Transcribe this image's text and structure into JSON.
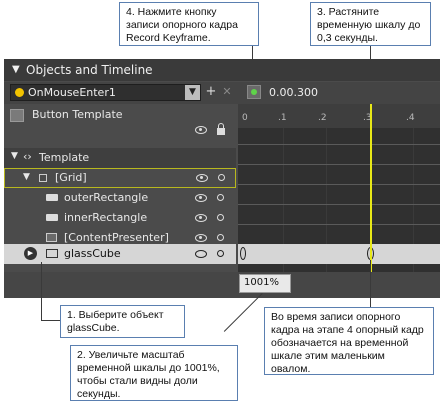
{
  "callouts": {
    "c4": "4. Нажмите кнопку записи опорного кадра Record Keyframe.",
    "c3": "3. Растяните временную шкалу до 0,3 секунды.",
    "c1": "1. Выберите объект glassCube.",
    "c2": "2. Увеличьте масштаб временной шкалы до 1001%, чтобы стали видны доли секунды.",
    "c5": "Во время записи опорного кадра на этапе 4 опорный кадр обозначается на временной шкале этим маленьким овалом."
  },
  "panel": {
    "title": "Objects and Timeline",
    "storyboard": "OnMouseEnter1",
    "time_display": "0.00.300",
    "zoom": "1001%"
  },
  "tree": {
    "scope": "Button Template",
    "items": [
      {
        "label": "Template"
      },
      {
        "label": "[Grid]"
      },
      {
        "label": "outerRectangle"
      },
      {
        "label": "innerRectangle"
      },
      {
        "label": "[ContentPresenter]"
      },
      {
        "label": "glassCube"
      }
    ]
  },
  "ruler": {
    "ticks": [
      "0",
      ".1",
      ".2",
      ".3",
      ".4"
    ]
  },
  "colors": {
    "panel_bg": "#4b4b4b",
    "header_bg": "#3a3a3a",
    "playhead": "#e8e817",
    "accent_border": "#5a7fb0",
    "selected_row": "#d6d6d6"
  }
}
